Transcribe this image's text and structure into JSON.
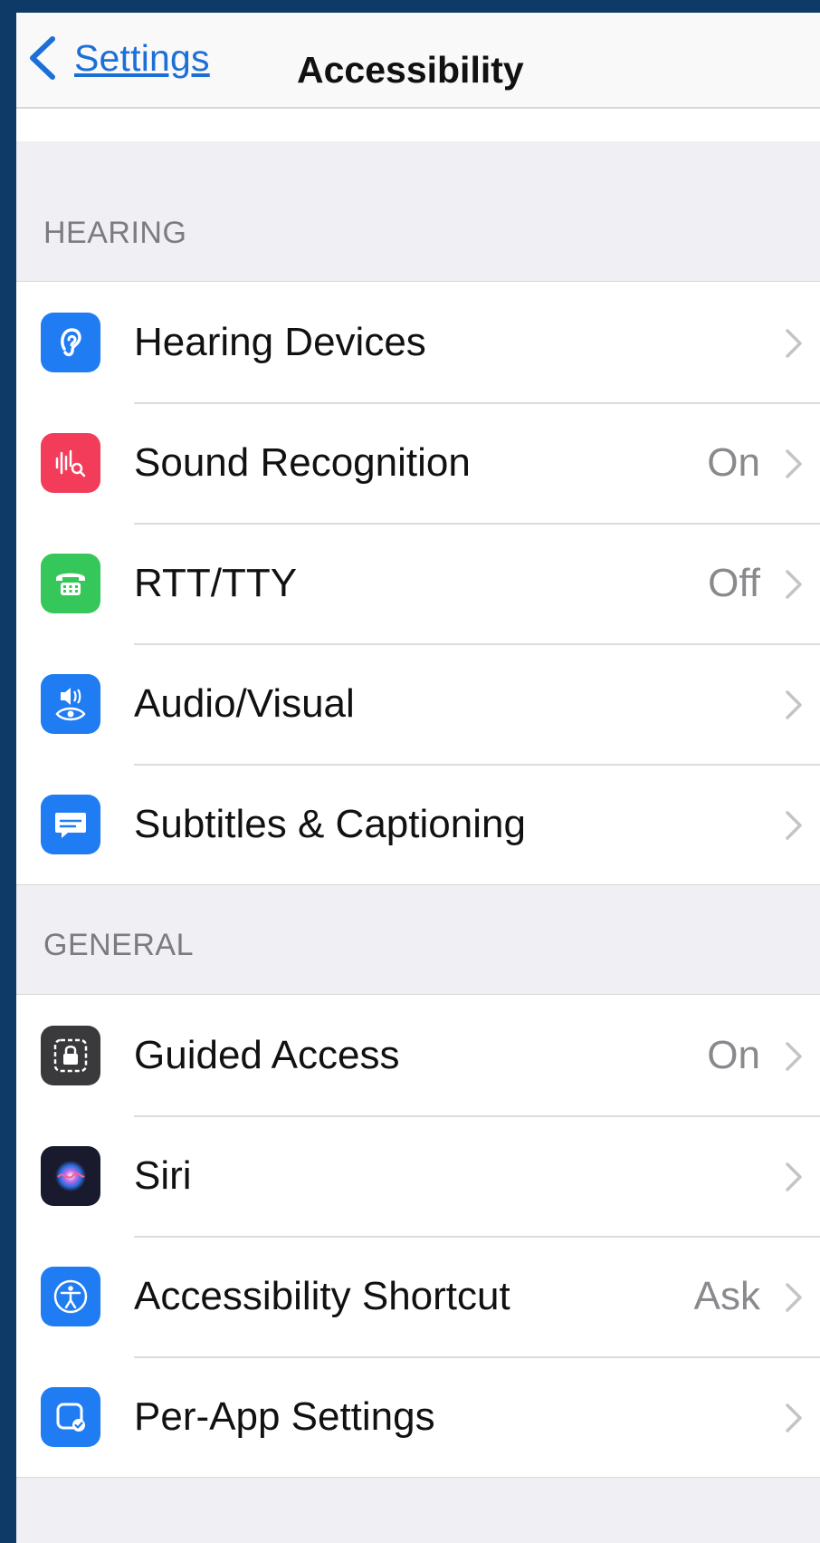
{
  "nav": {
    "back_label": "Settings",
    "title": "Accessibility"
  },
  "sections": [
    {
      "header": "HEARING",
      "items": [
        {
          "label": "Hearing Devices",
          "value": "",
          "icon": "ear-icon",
          "color": "#1f7cf2"
        },
        {
          "label": "Sound Recognition",
          "value": "On",
          "icon": "waveform-search-icon",
          "color": "#f23c5a"
        },
        {
          "label": "RTT/TTY",
          "value": "Off",
          "icon": "tty-phone-icon",
          "color": "#35c759"
        },
        {
          "label": "Audio/Visual",
          "value": "",
          "icon": "speaker-eye-icon",
          "color": "#1f7cf2"
        },
        {
          "label": "Subtitles & Captioning",
          "value": "",
          "icon": "caption-bubble-icon",
          "color": "#1f7cf2"
        }
      ]
    },
    {
      "header": "GENERAL",
      "items": [
        {
          "label": "Guided Access",
          "value": "On",
          "icon": "lock-frame-icon",
          "color": "#3a3a3c"
        },
        {
          "label": "Siri",
          "value": "",
          "icon": "siri-icon",
          "color": "#1a1a2e"
        },
        {
          "label": "Accessibility Shortcut",
          "value": "Ask",
          "icon": "accessibility-icon",
          "color": "#1f7cf2"
        },
        {
          "label": "Per-App Settings",
          "value": "",
          "icon": "app-settings-icon",
          "color": "#1f7cf2"
        }
      ]
    }
  ]
}
